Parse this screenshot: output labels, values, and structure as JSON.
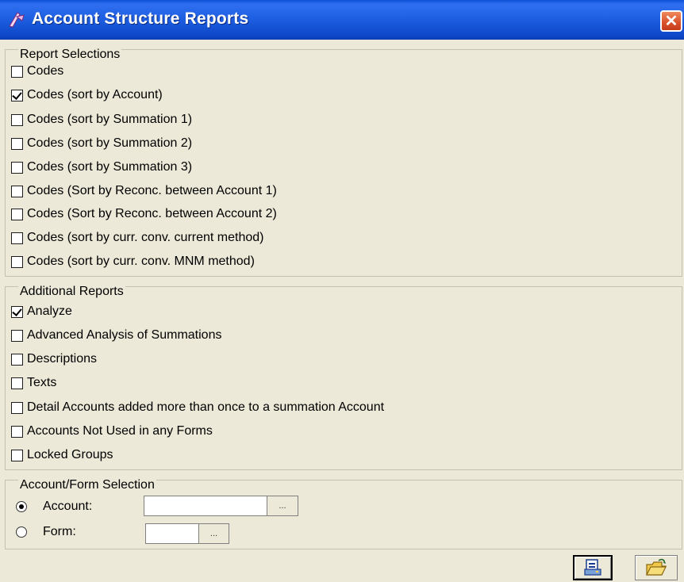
{
  "window": {
    "title": "Account Structure Reports",
    "close_label": "✕"
  },
  "report_selections": {
    "legend": "Report Selections",
    "items": [
      {
        "label": "Codes",
        "checked": false
      },
      {
        "label": "Codes (sort by Account)",
        "checked": true
      },
      {
        "label": "Codes (sort by Summation 1)",
        "checked": false
      },
      {
        "label": "Codes (sort by Summation 2)",
        "checked": false
      },
      {
        "label": "Codes (sort by Summation 3)",
        "checked": false
      },
      {
        "label": "Codes (Sort by Reconc. between Account 1)",
        "checked": false
      },
      {
        "label": "Codes (Sort by Reconc. between Account 2)",
        "checked": false
      },
      {
        "label": "Codes (sort by curr. conv. current method)",
        "checked": false
      },
      {
        "label": "Codes (sort by curr. conv. MNM method)",
        "checked": false
      }
    ]
  },
  "additional_reports": {
    "legend": "Additional Reports",
    "items": [
      {
        "label": "Analyze",
        "checked": true
      },
      {
        "label": "Advanced Analysis of Summations",
        "checked": false
      },
      {
        "label": "Descriptions",
        "checked": false
      },
      {
        "label": "Texts",
        "checked": false
      },
      {
        "label": "Detail Accounts added more than once to a summation Account",
        "checked": false
      },
      {
        "label": "Accounts Not Used in any Forms",
        "checked": false
      },
      {
        "label": "Locked Groups",
        "checked": false
      }
    ]
  },
  "account_form_selection": {
    "legend": "Account/Form Selection",
    "account_label": "Account:",
    "account_value": "",
    "form_label": "Form:",
    "form_value": "",
    "browse_label": "...",
    "selected": "account"
  },
  "toolbar": {
    "print_icon": "print-preview-icon",
    "open_icon": "open-folder-icon"
  }
}
